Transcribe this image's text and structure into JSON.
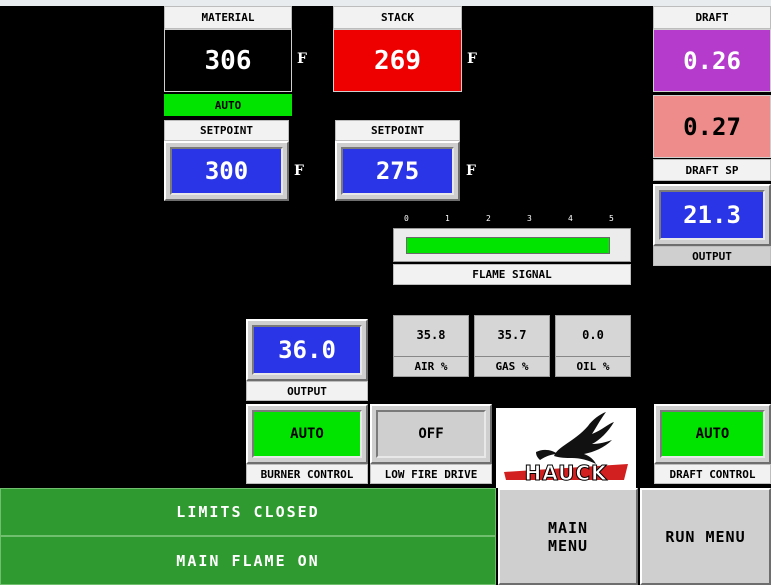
{
  "material": {
    "label": "MATERIAL",
    "value": "306",
    "unit": "F",
    "mode": "AUTO"
  },
  "material_setpoint": {
    "label": "SETPOINT",
    "value": "300",
    "unit": "F"
  },
  "stack": {
    "label": "STACK",
    "value": "269",
    "unit": "F"
  },
  "stack_setpoint": {
    "label": "SETPOINT",
    "value": "275",
    "unit": "F"
  },
  "draft": {
    "label": "DRAFT",
    "value": "0.26",
    "setpoint_value": "0.27",
    "setpoint_label": "DRAFT SP",
    "output_value": "21.3",
    "output_label": "OUTPUT"
  },
  "flame": {
    "ticks": [
      "0",
      "1",
      "2",
      "3",
      "4",
      "5"
    ],
    "label": "FLAME SIGNAL",
    "level_fraction": 1.0
  },
  "burner_output": {
    "value": "36.0",
    "label": "OUTPUT"
  },
  "air": {
    "value": "35.8",
    "label": "AIR %"
  },
  "gas": {
    "value": "35.7",
    "label": "GAS %"
  },
  "oil": {
    "value": "0.0",
    "label": "OIL %"
  },
  "burner_control": {
    "state": "AUTO",
    "label": "BURNER CONTROL"
  },
  "low_fire_drive": {
    "state": "OFF",
    "label": "LOW FIRE DRIVE"
  },
  "logo": {
    "text": "HAUCK"
  },
  "draft_control": {
    "state": "AUTO",
    "label": "DRAFT CONTROL"
  },
  "status": {
    "line1": "LIMITS CLOSED",
    "line2": "MAIN FLAME ON"
  },
  "nav": {
    "main_menu_line1": "MAIN",
    "main_menu_line2": "MENU",
    "run_menu": "RUN MENU"
  },
  "colors": {
    "green": "#00e400",
    "blue": "#2b35e8",
    "red": "#ee0000",
    "purple": "#b43bcb",
    "pink": "#ee8c8c",
    "status_green": "#2f9a2f"
  }
}
